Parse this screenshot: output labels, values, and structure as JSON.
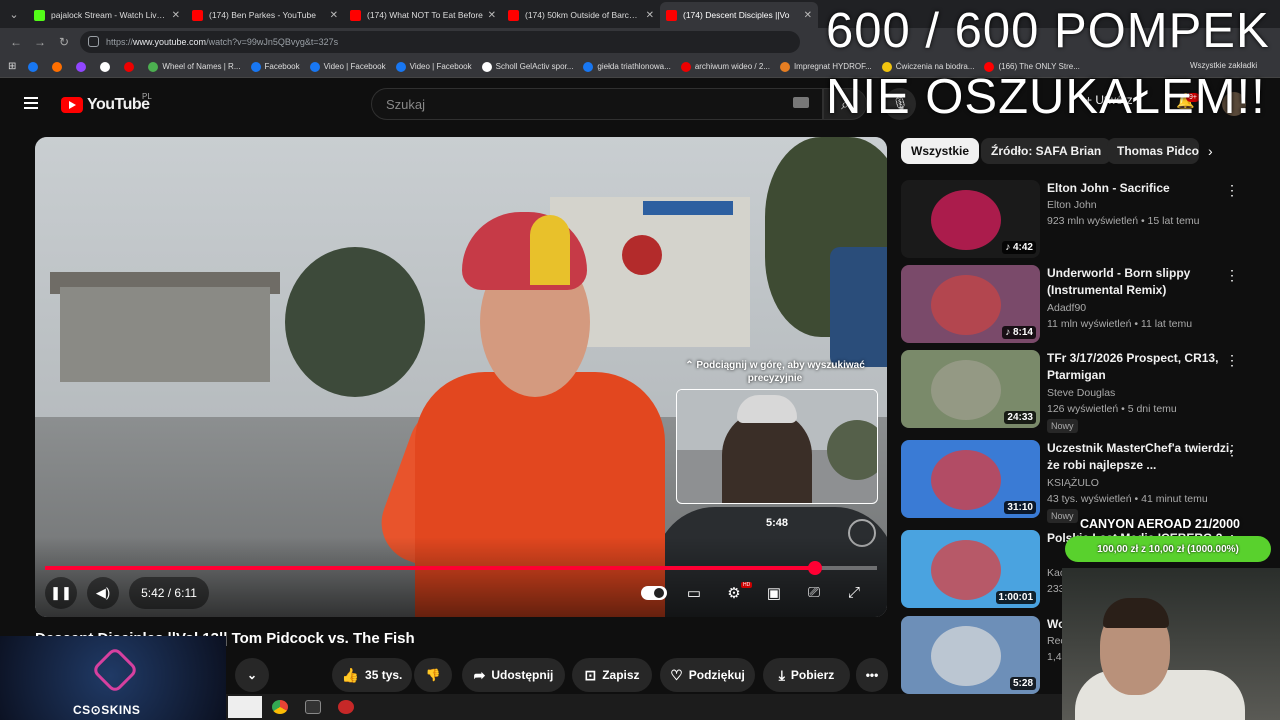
{
  "browser": {
    "tabs": [
      {
        "title": "pajalock Stream - Watch Live o",
        "fav": "#53fc18",
        "active": false
      },
      {
        "title": "(174) Ben Parkes - YouTube",
        "fav": "#ff0000",
        "active": false
      },
      {
        "title": "(174) What NOT To Eat Before",
        "fav": "#ff0000",
        "active": false
      },
      {
        "title": "(174) 50km Outside of Barcelon",
        "fav": "#ff0000",
        "active": false
      },
      {
        "title": "(174) Descent Disciples ||Vo",
        "fav": "#ff0000",
        "active": true
      }
    ],
    "url_prefix": "https://",
    "url_host": "www.youtube.com",
    "url_rest": "/watch?v=99wJn5QBvyg&t=327s",
    "bookmarks": [
      {
        "label": "",
        "color": "#1877f2"
      },
      {
        "label": "",
        "color": "#ff6f00"
      },
      {
        "label": "",
        "color": "#9146ff"
      },
      {
        "label": "",
        "color": "#ffffff"
      },
      {
        "label": "",
        "color": "#e00"
      },
      {
        "label": "Wheel of Names | R...",
        "color": "#4caf50"
      },
      {
        "label": "Facebook",
        "color": "#1877f2"
      },
      {
        "label": "Video | Facebook",
        "color": "#1877f2"
      },
      {
        "label": "Video | Facebook",
        "color": "#1877f2"
      },
      {
        "label": "Scholl GelActiv spor...",
        "color": "#fff"
      },
      {
        "label": "giełda triathlonowa...",
        "color": "#1877f2"
      },
      {
        "label": "archiwum wideo / 2...",
        "color": "#e00"
      },
      {
        "label": "Impregnat HYDROF...",
        "color": "#e67e22"
      },
      {
        "label": "Ćwiczenia na biodra...",
        "color": "#f1c40f"
      },
      {
        "label": "(166) The ONLY Stre...",
        "color": "#ff0000"
      }
    ],
    "all_bookmarks": "Wszystkie zakładki"
  },
  "youtube": {
    "logo": "YouTube",
    "country": "PL",
    "search_placeholder": "Szukaj",
    "create_label": "Utwórz",
    "notif_count": "9+"
  },
  "player": {
    "time": "5:42 / 6:11",
    "progress": 0.925,
    "swipe_hint": "⌃ Podciągnij w górę, aby wyszukiwać precyzyjnie",
    "preview_time": "5:48",
    "hd_badge": "HD"
  },
  "video": {
    "title": "Descent Disciples ||Vol 13|| Tom Pidcock vs. The Fish",
    "likes": "35 tys.",
    "share": "Udostępnij",
    "save": "Zapisz",
    "thanks": "Podziękuj",
    "download": "Pobierz"
  },
  "sidebar": {
    "chips": [
      "Wszystkie",
      "Źródło: SAFA Brian",
      "Thomas Pidco"
    ],
    "recs": [
      {
        "title": "Elton John - Sacrifice",
        "channel": "Elton John",
        "meta": "923 mln wyświetleń • 15 lat temu",
        "duration": "♪ 4:42",
        "new": "",
        "bg": "#1a1a1a",
        "accent": "#e91e63"
      },
      {
        "title": "Underworld - Born slippy (Instrumental Remix)",
        "channel": "Adadf90",
        "meta": "11 mln wyświetleń • 11 lat temu",
        "duration": "♪ 8:14",
        "new": "",
        "bg": "#7a4a6a",
        "accent": "#c44"
      },
      {
        "title": "TFr  3/17/2026  Prospect, CR13, Ptarmigan",
        "channel": "Steve Douglas",
        "meta": "126 wyświetleń • 5 dni temu",
        "duration": "24:33",
        "new": "Nowy",
        "bg": "#7a8a6a",
        "accent": "#a0a090"
      },
      {
        "title": "Uczestnik MasterChef'a twierdzi, że robi najlepsze ...",
        "channel": "KSIĄŻULO",
        "meta": "43 tys. wyświetleń • 41 minut temu",
        "duration": "31:10",
        "new": "Nowy",
        "bg": "#3a7bd5",
        "accent": "#e53935"
      },
      {
        "title": "Polskie Last Media ICEBERG 2",
        "channel": "Kac",
        "meta": "233",
        "duration": "1:00:01",
        "new": "",
        "bg": "#4aa3e0",
        "accent": "#e53935"
      },
      {
        "title": "Wo Pic",
        "channel": "Rec",
        "meta": "1,4",
        "duration": "5:28",
        "new": "",
        "bg": "#6d8fb8",
        "accent": "#ddd"
      }
    ]
  },
  "overlay": {
    "line1": "600 / 600 POMPEK",
    "line2": "NIE OSZUKAŁEM!!",
    "goal_title": "CANYON AEROAD 21/2000",
    "goal_bar": "100,00 zł z 10,00 zł (1000.00%)",
    "sponsor": "CS⊙SKINS"
  }
}
